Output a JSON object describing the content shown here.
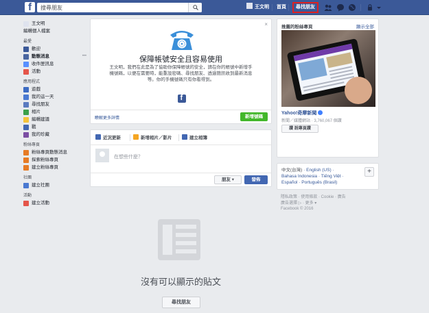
{
  "topbar": {
    "logo": "f",
    "search_placeholder": "搜尋朋友",
    "user_name": "王文明",
    "home": "首頁",
    "find_friends": "尋找朋友",
    "brand_color": "#3b5998",
    "highlight_color": "#e02020"
  },
  "sidebar": {
    "profile": [
      {
        "label": "王文明"
      },
      {
        "label": "編輯個人檔案"
      }
    ],
    "favorites_title": "最愛",
    "favorites": [
      {
        "label": "歡迎",
        "icon": "welcome-icon"
      },
      {
        "label": "動態消息",
        "icon": "news-feed-icon",
        "more": "•••"
      },
      {
        "label": "收件匣訊息",
        "icon": "messages-icon"
      },
      {
        "label": "活動",
        "icon": "events-icon"
      }
    ],
    "apps_title": "應用程式",
    "apps": [
      {
        "label": "遊戲",
        "icon": "games-icon"
      },
      {
        "label": "我的這一天",
        "icon": "on-this-day-icon"
      },
      {
        "label": "尋找朋友",
        "icon": "find-friends-icon"
      },
      {
        "label": "相片",
        "icon": "photos-icon"
      },
      {
        "label": "編輯建議",
        "icon": "suggest-edits-icon"
      },
      {
        "label": "戳",
        "icon": "pokes-icon"
      },
      {
        "label": "我的珍藏",
        "icon": "saved-icon"
      }
    ],
    "pages_title": "粉絲專頁",
    "pages": [
      {
        "label": "粉絲專頁動態消息",
        "icon": "pages-feed-icon"
      },
      {
        "label": "探索粉絲專頁",
        "icon": "discover-pages-icon"
      },
      {
        "label": "建立粉絲專頁",
        "icon": "create-page-icon"
      }
    ],
    "groups_title": "社團",
    "groups": [
      {
        "label": "建立社團",
        "icon": "create-group-icon"
      }
    ],
    "events_title": "活動",
    "events": [
      {
        "label": "建立活動",
        "icon": "create-event-icon"
      }
    ]
  },
  "security_card": {
    "close": "×",
    "title": "保障帳號安全且容易使用",
    "body": "王文明，我們在此是為了協助你保障帳號的安全，請在你的帳號中新增手機號碼，以便在需要時，能重設密碼、尋找朋友、透過簡訊收到最新消息等。你的手機號碼只有你看得到。",
    "learn_more": "瞭解更多詳情",
    "add_phone": "新增號碼"
  },
  "composer": {
    "tab_status": "近況更新",
    "tab_photo": "新增相片／影片",
    "tab_album": "建立相簿",
    "placeholder": "在想些什麼？",
    "audience": "朋友 ▾",
    "post": "發佈"
  },
  "feed": {
    "empty_text": "沒有可以顯示的貼文",
    "find_friends": "尋找朋友"
  },
  "ads": {
    "heading": "推薦的粉絲專頁",
    "see_all": "顯示全部",
    "page_name": "Yahoo!奇摩新聞",
    "meta": "新聞／媒體網站 · 3,760,067 個讚",
    "like": "讚 說專頁讚"
  },
  "languages": {
    "current": "中文(台灣)",
    "line1_rest": " · English (US) · ",
    "line2": "Bahasa Indonesia · Tiếng Việt · ",
    "line3": "Español · Português (Brasil)",
    "add": "+"
  },
  "footer": {
    "line1": "隱私政策 · 使用條款 · Cookie · 廣告",
    "line2": "廣告選擇 ▷ · 更多 ▾",
    "line3": "Facebook © 2016"
  }
}
